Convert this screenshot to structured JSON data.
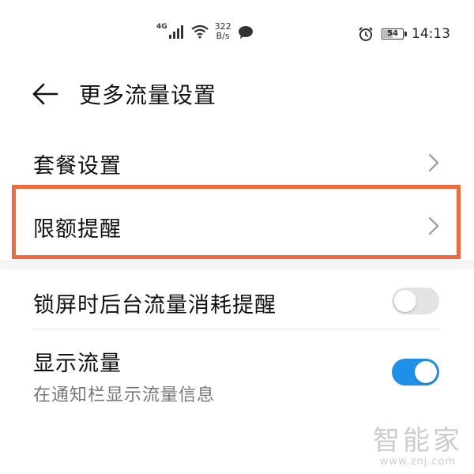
{
  "status_bar": {
    "network_type": "4G",
    "speed_value": "322",
    "speed_unit": "B/s",
    "battery_level": 54,
    "battery_text": "54",
    "time": "14:13"
  },
  "header": {
    "title": "更多流量设置",
    "back_icon": "arrow-left-icon"
  },
  "list": {
    "plan_settings": {
      "label": "套餐设置",
      "icon": "chevron-right-icon"
    },
    "limit_reminder": {
      "label": "限额提醒",
      "icon": "chevron-right-icon"
    },
    "lock_screen_reminder": {
      "label": "锁屏时后台流量消耗提醒",
      "enabled": false
    },
    "show_traffic": {
      "label": "显示流量",
      "sublabel": "在通知栏显示流量信息",
      "enabled": true
    }
  },
  "colors": {
    "highlight": "#f06a3c",
    "toggle_on": "#1e90e8",
    "toggle_off": "#e3e3e3"
  },
  "watermark": {
    "main": "智能家",
    "sub": "www.znj.com"
  }
}
